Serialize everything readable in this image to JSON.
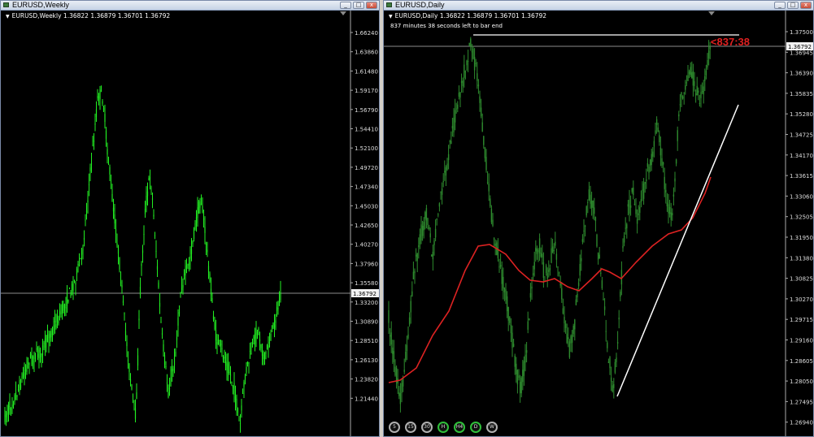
{
  "left_window": {
    "title": "EURUSD,Weekly",
    "ohlc": "EURUSD,Weekly  1.36822 1.36879 1.36701 1.36792",
    "price_ticks": [
      "1.66240",
      "1.63860",
      "1.61480",
      "1.59170",
      "1.56790",
      "1.54410",
      "1.52100",
      "1.49720",
      "1.47340",
      "1.45030",
      "1.42650",
      "1.40270",
      "1.37960",
      "1.35580",
      "1.33200",
      "1.30890",
      "1.28510",
      "1.26130",
      "1.23820",
      "1.21440"
    ],
    "current_price": "1.36792",
    "colors": {
      "candles": "#22ee22",
      "background": "#000000",
      "price_line": "#c0c0c0"
    }
  },
  "right_window": {
    "title": "EURUSD,Daily",
    "ohlc": "EURUSD,Daily  1.36822 1.36879 1.36701 1.36792",
    "note": "837 minutes 38 seconds left to bar end",
    "countdown": "<837:38",
    "price_ticks": [
      "1.37500",
      "1.36945",
      "1.36390",
      "1.35835",
      "1.35280",
      "1.34725",
      "1.34170",
      "1.33615",
      "1.33060",
      "1.32505",
      "1.31950",
      "1.31380",
      "1.30825",
      "1.30270",
      "1.29715",
      "1.29160",
      "1.28605",
      "1.28050",
      "1.27495",
      "1.26940"
    ],
    "current_price": "1.36792",
    "timeframes": [
      {
        "label": "5",
        "active": false
      },
      {
        "label": "15",
        "active": false
      },
      {
        "label": "30",
        "active": false
      },
      {
        "label": "H",
        "active": true
      },
      {
        "label": "H4",
        "active": true
      },
      {
        "label": "D",
        "active": true
      },
      {
        "label": "W",
        "active": false
      }
    ],
    "colors": {
      "candles": "#2e8b2e",
      "moving_average": "#dd2222",
      "trendline": "#ffffff"
    }
  },
  "window_buttons": {
    "minimize": "_",
    "maximize": "□",
    "close": "x"
  }
}
